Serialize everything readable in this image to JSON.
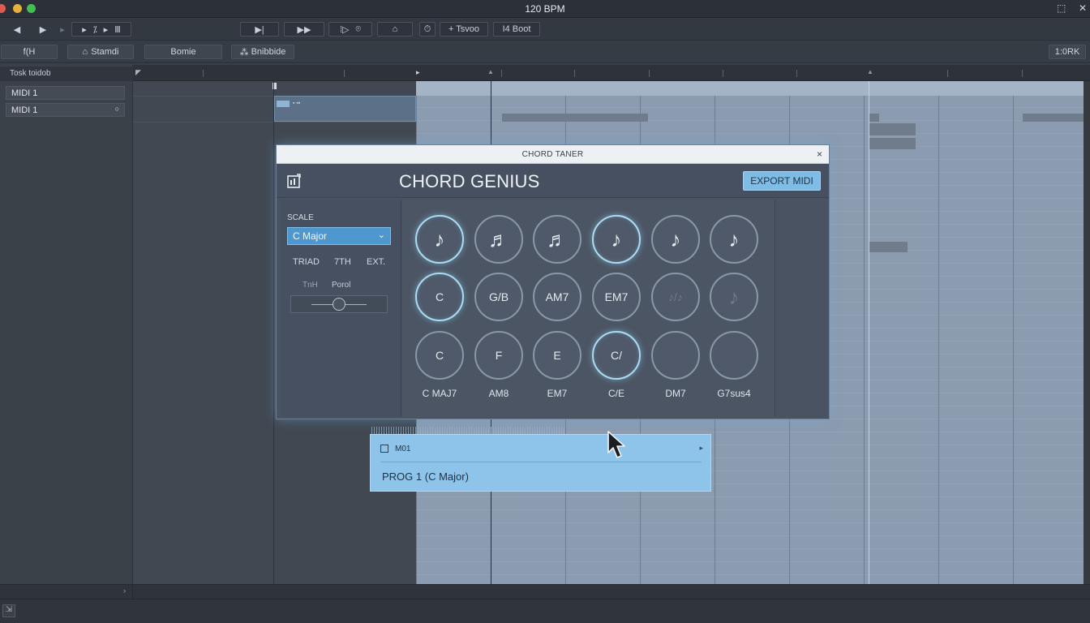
{
  "window": {
    "title": "120 BPM"
  },
  "toolbar": {
    "buttons": [
      "◀",
      "▶",
      "▸",
      "▸",
      "⁒",
      "▸",
      "Ⅲ",
      "▶|",
      "▶▶",
      "⁞▷",
      "⌾",
      "⌂",
      "⏱",
      "+ Tsvoo",
      "I4 Boot"
    ]
  },
  "tabs": {
    "t1": "f(H",
    "t2": "Stamdi",
    "t3": "Bomie",
    "t4": "Bnibbide",
    "right": "1:0RK"
  },
  "tracks": {
    "header": "Tosk toidob",
    "items": [
      "MIDI 1",
      "MIDI 1"
    ]
  },
  "modal": {
    "window_title": "CHORD TANER",
    "close": "×",
    "app_title": "CHORD GENIUS",
    "export_label": "EXPORT MIDI",
    "scale_label": "SCALE",
    "scale_value": "C Major",
    "segments": [
      "TRIAD",
      "7TH",
      "EXT."
    ],
    "slider_labels": [
      "TnH",
      "Porol"
    ],
    "pads_row1": [
      "♪",
      "♬",
      "♬",
      "♪",
      "♪",
      "♪"
    ],
    "pads_row2": [
      "C",
      "G/B",
      "AM7",
      "EM7",
      "♪/♪",
      "♪"
    ],
    "pads_row3": [
      "C",
      "F",
      "E",
      "C/",
      "",
      ""
    ],
    "pad_labels": [
      "C MAJ7",
      "AM8",
      "EM7",
      "C/E",
      "DM7",
      "G7sus4"
    ]
  },
  "dropdown": {
    "header": "M01",
    "item": "PROG 1 (C Major)"
  },
  "status": {
    "icon": "⇲"
  }
}
